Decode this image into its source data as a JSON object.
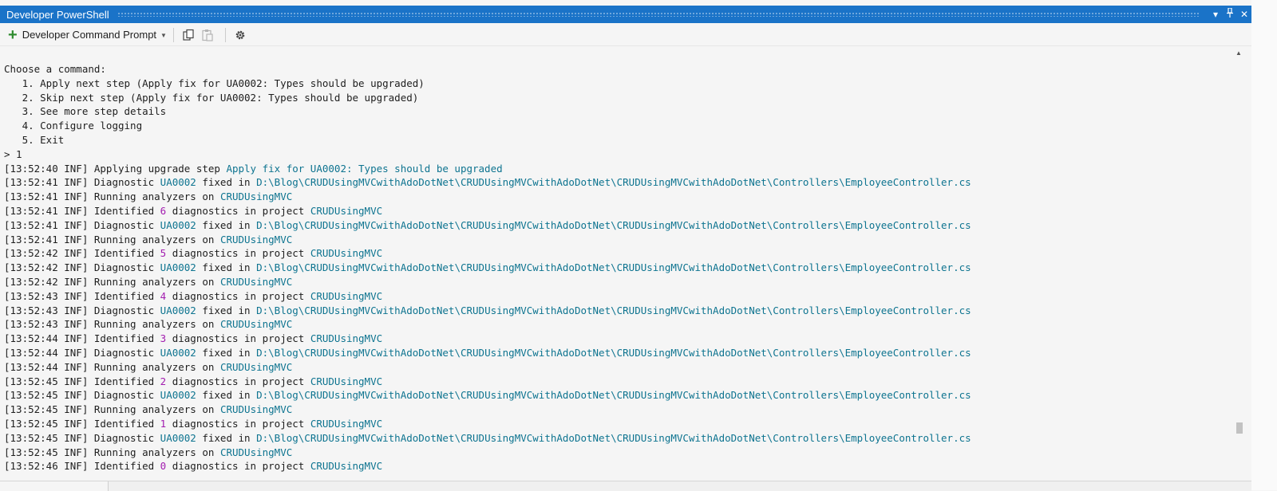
{
  "window": {
    "title": "Developer PowerShell",
    "controls": {
      "dropdown_icon": "▾",
      "pin_icon": "⊥",
      "close_icon": "✕"
    }
  },
  "toolbar": {
    "new_terminal_label": "Developer Command Prompt",
    "icons": [
      "plus-icon",
      "chevron-down-icon",
      "copy-icon",
      "paste-icon",
      "gear-icon"
    ]
  },
  "terminal": {
    "lines": [
      [
        {
          "t": "Choose a command:"
        }
      ],
      [
        {
          "t": "   1. Apply next step (Apply fix for UA0002: Types should be upgraded)"
        }
      ],
      [
        {
          "t": "   2. Skip next step (Apply fix for UA0002: Types should be upgraded)"
        }
      ],
      [
        {
          "t": "   3. See more step details"
        }
      ],
      [
        {
          "t": "   4. Configure logging"
        }
      ],
      [
        {
          "t": "   5. Exit"
        }
      ],
      [
        {
          "t": "> 1"
        }
      ],
      [
        {
          "t": "[13:52:40 INF] Applying upgrade step "
        },
        {
          "t": "Apply fix for UA0002: Types should be upgraded",
          "c": "cyan"
        }
      ],
      [
        {
          "t": "[13:52:41 INF] Diagnostic "
        },
        {
          "t": "UA0002",
          "c": "cyan"
        },
        {
          "t": " fixed in "
        },
        {
          "t": "D:\\Blog\\CRUDUsingMVCwithAdoDotNet\\CRUDUsingMVCwithAdoDotNet\\CRUDUsingMVCwithAdoDotNet\\Controllers\\EmployeeController.cs",
          "c": "cyan"
        }
      ],
      [
        {
          "t": "[13:52:41 INF] Running analyzers on "
        },
        {
          "t": "CRUDUsingMVC",
          "c": "cyan"
        }
      ],
      [
        {
          "t": "[13:52:41 INF] Identified "
        },
        {
          "t": "6",
          "c": "magenta"
        },
        {
          "t": " diagnostics in project "
        },
        {
          "t": "CRUDUsingMVC",
          "c": "cyan"
        }
      ],
      [
        {
          "t": "[13:52:41 INF] Diagnostic "
        },
        {
          "t": "UA0002",
          "c": "cyan"
        },
        {
          "t": " fixed in "
        },
        {
          "t": "D:\\Blog\\CRUDUsingMVCwithAdoDotNet\\CRUDUsingMVCwithAdoDotNet\\CRUDUsingMVCwithAdoDotNet\\Controllers\\EmployeeController.cs",
          "c": "cyan"
        }
      ],
      [
        {
          "t": "[13:52:41 INF] Running analyzers on "
        },
        {
          "t": "CRUDUsingMVC",
          "c": "cyan"
        }
      ],
      [
        {
          "t": "[13:52:42 INF] Identified "
        },
        {
          "t": "5",
          "c": "magenta"
        },
        {
          "t": " diagnostics in project "
        },
        {
          "t": "CRUDUsingMVC",
          "c": "cyan"
        }
      ],
      [
        {
          "t": "[13:52:42 INF] Diagnostic "
        },
        {
          "t": "UA0002",
          "c": "cyan"
        },
        {
          "t": " fixed in "
        },
        {
          "t": "D:\\Blog\\CRUDUsingMVCwithAdoDotNet\\CRUDUsingMVCwithAdoDotNet\\CRUDUsingMVCwithAdoDotNet\\Controllers\\EmployeeController.cs",
          "c": "cyan"
        }
      ],
      [
        {
          "t": "[13:52:42 INF] Running analyzers on "
        },
        {
          "t": "CRUDUsingMVC",
          "c": "cyan"
        }
      ],
      [
        {
          "t": "[13:52:43 INF] Identified "
        },
        {
          "t": "4",
          "c": "magenta"
        },
        {
          "t": " diagnostics in project "
        },
        {
          "t": "CRUDUsingMVC",
          "c": "cyan"
        }
      ],
      [
        {
          "t": "[13:52:43 INF] Diagnostic "
        },
        {
          "t": "UA0002",
          "c": "cyan"
        },
        {
          "t": " fixed in "
        },
        {
          "t": "D:\\Blog\\CRUDUsingMVCwithAdoDotNet\\CRUDUsingMVCwithAdoDotNet\\CRUDUsingMVCwithAdoDotNet\\Controllers\\EmployeeController.cs",
          "c": "cyan"
        }
      ],
      [
        {
          "t": "[13:52:43 INF] Running analyzers on "
        },
        {
          "t": "CRUDUsingMVC",
          "c": "cyan"
        }
      ],
      [
        {
          "t": "[13:52:44 INF] Identified "
        },
        {
          "t": "3",
          "c": "magenta"
        },
        {
          "t": " diagnostics in project "
        },
        {
          "t": "CRUDUsingMVC",
          "c": "cyan"
        }
      ],
      [
        {
          "t": "[13:52:44 INF] Diagnostic "
        },
        {
          "t": "UA0002",
          "c": "cyan"
        },
        {
          "t": " fixed in "
        },
        {
          "t": "D:\\Blog\\CRUDUsingMVCwithAdoDotNet\\CRUDUsingMVCwithAdoDotNet\\CRUDUsingMVCwithAdoDotNet\\Controllers\\EmployeeController.cs",
          "c": "cyan"
        }
      ],
      [
        {
          "t": "[13:52:44 INF] Running analyzers on "
        },
        {
          "t": "CRUDUsingMVC",
          "c": "cyan"
        }
      ],
      [
        {
          "t": "[13:52:45 INF] Identified "
        },
        {
          "t": "2",
          "c": "magenta"
        },
        {
          "t": " diagnostics in project "
        },
        {
          "t": "CRUDUsingMVC",
          "c": "cyan"
        }
      ],
      [
        {
          "t": "[13:52:45 INF] Diagnostic "
        },
        {
          "t": "UA0002",
          "c": "cyan"
        },
        {
          "t": " fixed in "
        },
        {
          "t": "D:\\Blog\\CRUDUsingMVCwithAdoDotNet\\CRUDUsingMVCwithAdoDotNet\\CRUDUsingMVCwithAdoDotNet\\Controllers\\EmployeeController.cs",
          "c": "cyan"
        }
      ],
      [
        {
          "t": "[13:52:45 INF] Running analyzers on "
        },
        {
          "t": "CRUDUsingMVC",
          "c": "cyan"
        }
      ],
      [
        {
          "t": "[13:52:45 INF] Identified "
        },
        {
          "t": "1",
          "c": "magenta"
        },
        {
          "t": " diagnostics in project "
        },
        {
          "t": "CRUDUsingMVC",
          "c": "cyan"
        }
      ],
      [
        {
          "t": "[13:52:45 INF] Diagnostic "
        },
        {
          "t": "UA0002",
          "c": "cyan"
        },
        {
          "t": " fixed in "
        },
        {
          "t": "D:\\Blog\\CRUDUsingMVCwithAdoDotNet\\CRUDUsingMVCwithAdoDotNet\\CRUDUsingMVCwithAdoDotNet\\Controllers\\EmployeeController.cs",
          "c": "cyan"
        }
      ],
      [
        {
          "t": "[13:52:45 INF] Running analyzers on "
        },
        {
          "t": "CRUDUsingMVC",
          "c": "cyan"
        }
      ],
      [
        {
          "t": "[13:52:46 INF] Identified "
        },
        {
          "t": "0",
          "c": "magenta"
        },
        {
          "t": " diagnostics in project "
        },
        {
          "t": "CRUDUsingMVC",
          "c": "cyan"
        }
      ]
    ]
  },
  "scrollbar": {
    "up_arrow": "▲"
  },
  "colors": {
    "titlebar": "#1a73c8",
    "highlight_cyan": "#0e7490",
    "highlight_magenta": "#a21caf",
    "background": "#f5f5f5"
  }
}
